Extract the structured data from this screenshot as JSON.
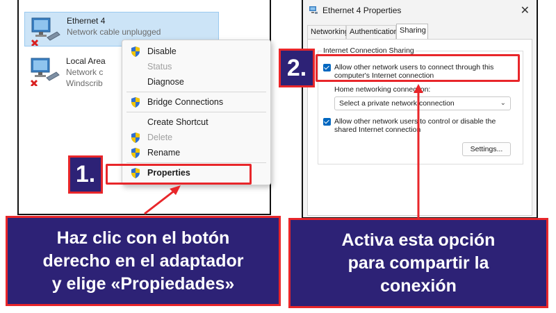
{
  "adapters": [
    {
      "name": "Ethernet 4",
      "status": "Network cable unplugged",
      "extra": ""
    },
    {
      "name": "Local Area",
      "status": "Network c",
      "extra": "Windscrib"
    }
  ],
  "context_menu": {
    "items": [
      {
        "label": "Disable",
        "icon": "shield-icon",
        "disabled": false
      },
      {
        "label": "Status",
        "icon": "",
        "disabled": true
      },
      {
        "label": "Diagnose",
        "icon": "",
        "disabled": false
      },
      {
        "label": "Bridge Connections",
        "icon": "shield-icon",
        "disabled": false
      },
      {
        "label": "Create Shortcut",
        "icon": "",
        "disabled": false
      },
      {
        "label": "Delete",
        "icon": "shield-icon",
        "disabled": true
      },
      {
        "label": "Rename",
        "icon": "shield-icon",
        "disabled": false
      },
      {
        "label": "Properties",
        "icon": "shield-icon",
        "disabled": false
      }
    ]
  },
  "steps": {
    "step1": "1.",
    "step2": "2."
  },
  "captions": {
    "left": [
      "Haz clic con el botón",
      "derecho en el adaptador",
      "y elige «Propiedades»"
    ],
    "right": [
      "Activa esta opción",
      "para compartir la",
      "conexión"
    ]
  },
  "properties_dialog": {
    "title": "Ethernet 4 Properties",
    "close": "✕",
    "tabs": [
      "Networking",
      "Authentication",
      "Sharing"
    ],
    "active_tab": "Sharing",
    "group_title": "Internet Connection Sharing",
    "allow_share_label": [
      "Allow other network users to connect through this",
      "computer's Internet connection"
    ],
    "home_networking_label": "Home networking connection:",
    "home_networking_value": "Select a private network connection",
    "allow_control_label": [
      "Allow other network users to control or disable the",
      "shared Internet connection"
    ],
    "settings_button": "Settings..."
  },
  "colors": {
    "accent_red": "#e8262a",
    "caption_bg": "#2d2276",
    "checkbox_blue": "#0067c0"
  }
}
